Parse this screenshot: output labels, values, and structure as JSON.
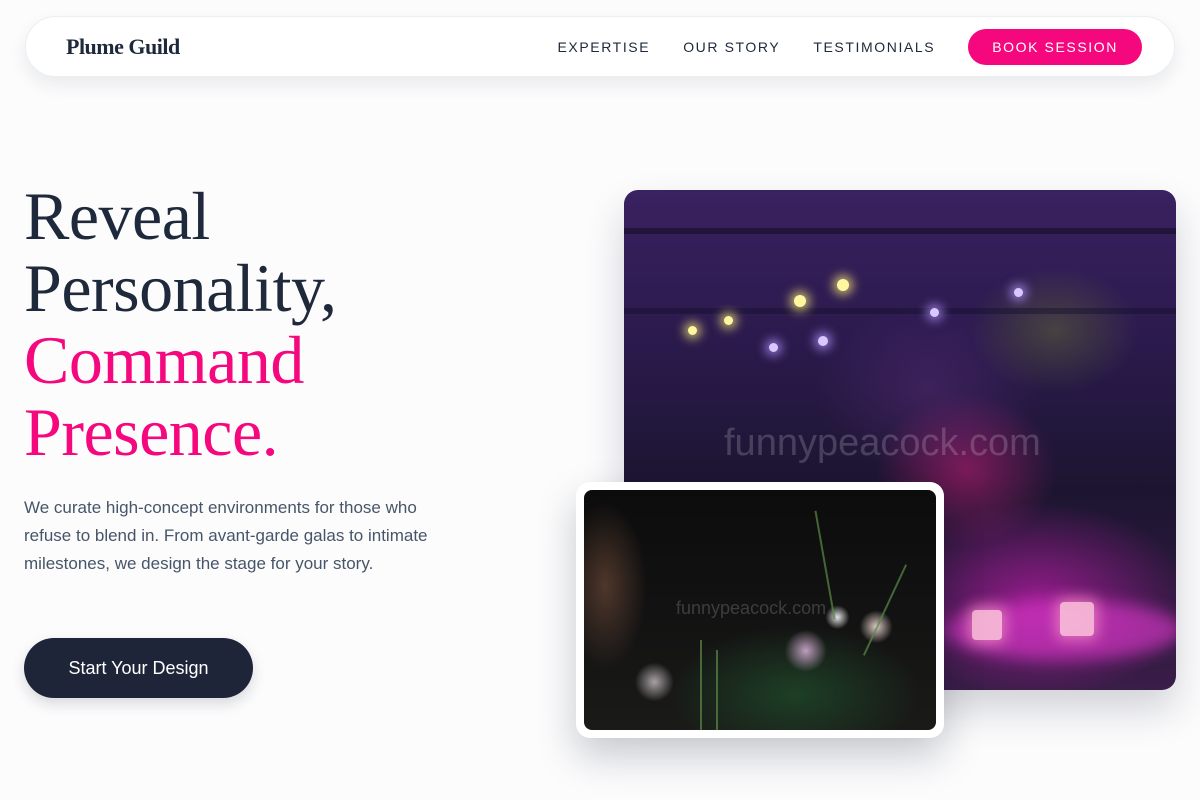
{
  "header": {
    "brand": "Plume Guild",
    "nav": [
      {
        "label": "EXPERTISE"
      },
      {
        "label": "OUR STORY"
      },
      {
        "label": "TESTIMONIALS"
      }
    ],
    "cta_label": "BOOK SESSION"
  },
  "hero": {
    "title_line1": "Reveal",
    "title_line2": "Personality,",
    "title_line3": "Command",
    "title_line4": "Presence.",
    "description": "We curate high-concept environments for those who refuse to blend in. From avant-garde galas to intimate milestones, we design the stage for your story.",
    "cta_label": "Start Your Design"
  },
  "images": {
    "main_watermark": "funnypeacock.com",
    "inset_watermark": "funnypeacock.com"
  },
  "colors": {
    "accent": "#f5077e",
    "dark": "#1e293b",
    "button_dark": "#1e2538",
    "body_text": "#475569",
    "background": "#fcfcfd"
  }
}
